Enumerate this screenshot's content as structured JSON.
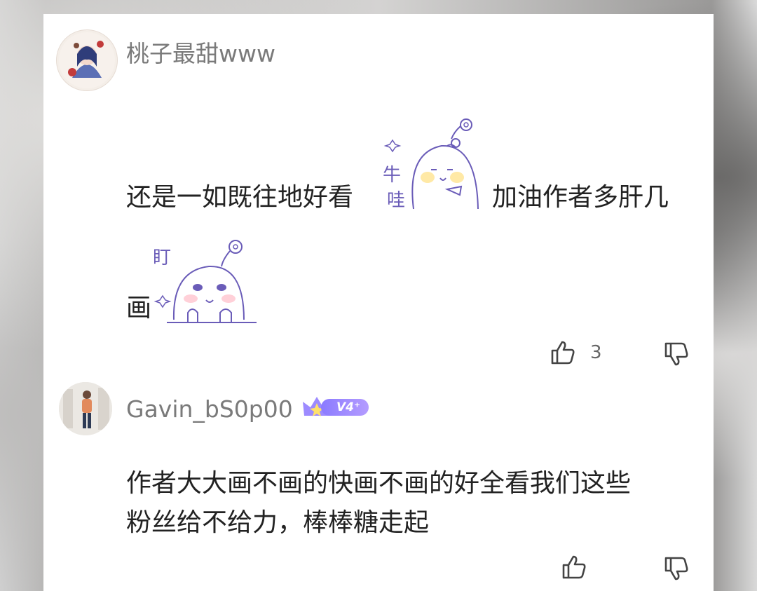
{
  "comments": [
    {
      "username": "桃子最甜www",
      "line1_a": "还是一如既往地好看",
      "sticker1_text": "哇",
      "line1_b": "加油作者多肝几",
      "line2": "画",
      "sticker2_text": "盯",
      "like_count": "3"
    },
    {
      "username": "Gavin_bS0p00",
      "badge": "V4⁺",
      "line1": "作者大大画不画的快画不画的好全看我们这些",
      "line2": "粉丝给不给力，棒棒糖走起",
      "like_count": ""
    }
  ],
  "colors": {
    "card": "#ffffff",
    "username": "#7a7a7a",
    "text": "#222222",
    "badge": "#9d8bff"
  },
  "icons": [
    "thumbs-up-icon",
    "thumbs-down-icon"
  ]
}
